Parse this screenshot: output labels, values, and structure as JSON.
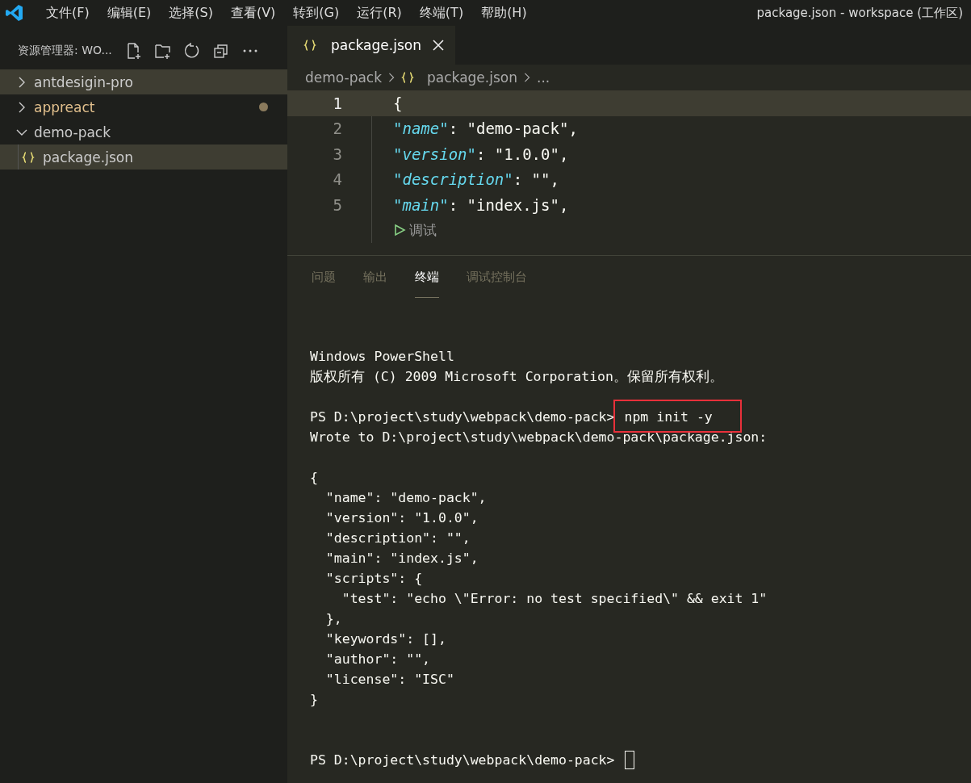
{
  "menu_bar": {
    "items": [
      "文件(F)",
      "编辑(E)",
      "选择(S)",
      "查看(V)",
      "转到(G)",
      "运行(R)",
      "终端(T)",
      "帮助(H)"
    ],
    "title": "package.json - workspace (工作区)"
  },
  "sidebar": {
    "title": "资源管理器: WO...",
    "items": [
      {
        "label": "antdesigin-pro",
        "kind": "folder",
        "expanded": false,
        "selected": true,
        "modified": false
      },
      {
        "label": "appreact",
        "kind": "folder",
        "expanded": false,
        "selected": false,
        "modified": true
      },
      {
        "label": "demo-pack",
        "kind": "folder",
        "expanded": true,
        "selected": false,
        "modified": false,
        "children": [
          {
            "label": "package.json",
            "kind": "json",
            "selected": true,
            "modified": false
          }
        ]
      }
    ]
  },
  "tabs": [
    {
      "label": "package.json",
      "selected": true
    }
  ],
  "breadcrumb": [
    "demo-pack",
    "package.json",
    "..."
  ],
  "editor": {
    "lines": [
      {
        "number": "1",
        "kind": "code",
        "tokens": [
          {
            "t": "{",
            "kind": "punct"
          }
        ]
      },
      {
        "number": "2",
        "kind": "code",
        "tokens": [
          {
            "t": "\"name\"",
            "kind": "key"
          },
          {
            "t": ": ",
            "kind": "punct"
          },
          {
            "t": "\"demo-pack\"",
            "kind": "string"
          },
          {
            "t": ",",
            "kind": "punct"
          }
        ]
      },
      {
        "number": "3",
        "kind": "code",
        "tokens": [
          {
            "t": "\"version\"",
            "kind": "key"
          },
          {
            "t": ": ",
            "kind": "punct"
          },
          {
            "t": "\"1.0.0\"",
            "kind": "string"
          },
          {
            "t": ",",
            "kind": "punct"
          }
        ]
      },
      {
        "number": "4",
        "kind": "code",
        "tokens": [
          {
            "t": "\"description\"",
            "kind": "key"
          },
          {
            "t": ": ",
            "kind": "punct"
          },
          {
            "t": "\"\"",
            "kind": "string"
          },
          {
            "t": ",",
            "kind": "punct"
          }
        ]
      },
      {
        "number": "5",
        "kind": "code",
        "tokens": [
          {
            "t": "\"main\"",
            "kind": "key"
          },
          {
            "t": ": ",
            "kind": "punct"
          },
          {
            "t": "\"index.js\"",
            "kind": "string"
          },
          {
            "t": ",",
            "kind": "punct"
          }
        ]
      },
      {
        "kind": "codelens",
        "label": "调试"
      }
    ]
  },
  "panel": {
    "tabs": [
      {
        "label": "问题",
        "selected": false
      },
      {
        "label": "输出",
        "selected": false
      },
      {
        "label": "终端",
        "selected": true
      },
      {
        "label": "调试控制台",
        "selected": false
      }
    ],
    "terminal": [
      {
        "kind": "text",
        "text": "Windows PowerShell"
      },
      {
        "kind": "text",
        "text": "版权所有 (C) 2009 Microsoft Corporation。保留所有权利。"
      },
      {
        "kind": "blank"
      },
      {
        "kind": "prompt",
        "prompt": "PS D:\\project\\study\\webpack\\demo-pack>",
        "command": "npm init -y",
        "highlighted": true
      },
      {
        "kind": "text",
        "text": "Wrote to D:\\project\\study\\webpack\\demo-pack\\package.json:"
      },
      {
        "kind": "blank"
      },
      {
        "kind": "text",
        "text": "{"
      },
      {
        "kind": "text",
        "text": "  \"name\": \"demo-pack\","
      },
      {
        "kind": "text",
        "text": "  \"version\": \"1.0.0\","
      },
      {
        "kind": "text",
        "text": "  \"description\": \"\","
      },
      {
        "kind": "text",
        "text": "  \"main\": \"index.js\","
      },
      {
        "kind": "text",
        "text": "  \"scripts\": {"
      },
      {
        "kind": "text",
        "text": "    \"test\": \"echo \\\"Error: no test specified\\\" && exit 1\""
      },
      {
        "kind": "text",
        "text": "  },"
      },
      {
        "kind": "text",
        "text": "  \"keywords\": [],"
      },
      {
        "kind": "text",
        "text": "  \"author\": \"\","
      },
      {
        "kind": "text",
        "text": "  \"license\": \"ISC\""
      },
      {
        "kind": "text",
        "text": "}"
      },
      {
        "kind": "blank"
      },
      {
        "kind": "blank"
      },
      {
        "kind": "prompt",
        "prompt": "PS D:\\project\\study\\webpack\\demo-pack>",
        "cursor": true
      }
    ]
  }
}
